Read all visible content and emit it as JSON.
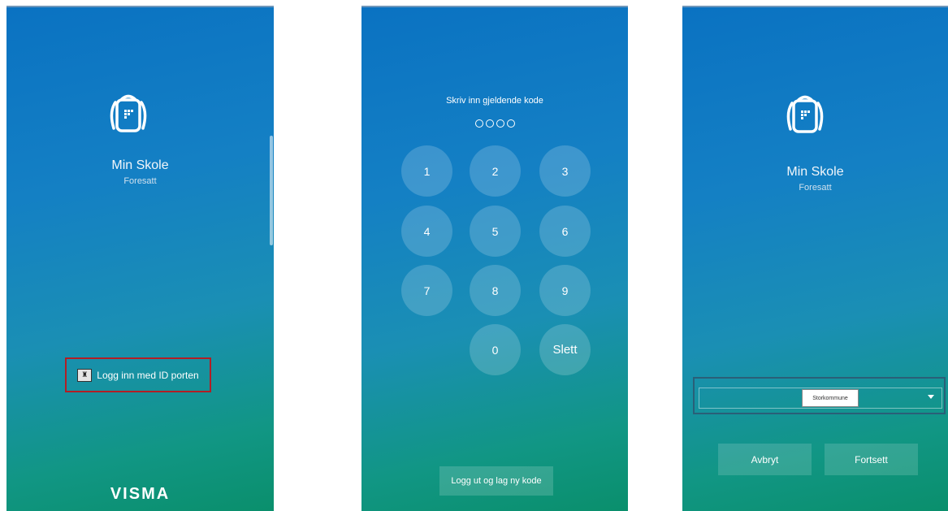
{
  "screen1": {
    "app_title": "Min Skole",
    "app_subtitle": "Foresatt",
    "login_button_label": "Logg inn med ID porten",
    "brand": "VISMA"
  },
  "screen2": {
    "pin_title": "Skriv inn gjeldende kode",
    "keys": [
      "1",
      "2",
      "3",
      "4",
      "5",
      "6",
      "7",
      "8",
      "9",
      "0",
      "Slett"
    ],
    "logout_button_label": "Logg ut og lag ny kode"
  },
  "screen3": {
    "app_title": "Min Skole",
    "app_subtitle": "Foresatt",
    "municipality_selected": "Storkommune",
    "cancel_label": "Avbryt",
    "continue_label": "Fortsett"
  },
  "icons": [
    "backpack-logo-icon",
    "id-porten-icon",
    "chevron-down-icon"
  ],
  "colors": {
    "gradient_top": "#0a72c2",
    "gradient_bottom": "#0a8f6c",
    "highlight_border": "#b21e25"
  }
}
